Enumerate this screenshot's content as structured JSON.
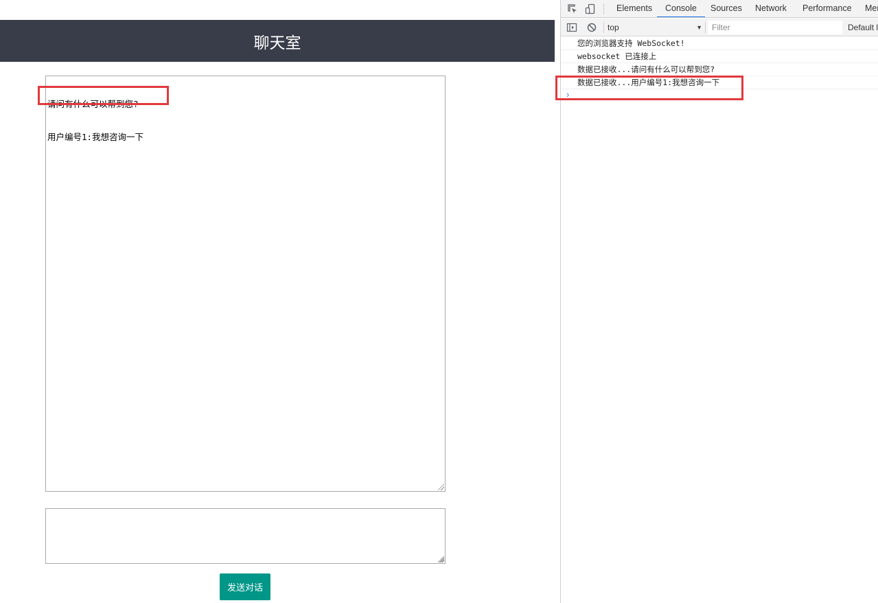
{
  "chat": {
    "title": "聊天室",
    "history": [
      "请问有什么可以帮到您?",
      "用户编号1:我想咨询一下"
    ],
    "input_value": "",
    "send_label": "发送对话"
  },
  "devtools": {
    "tabs": [
      {
        "label": "Elements"
      },
      {
        "label": "Console"
      },
      {
        "label": "Sources"
      },
      {
        "label": "Network"
      },
      {
        "label": "Performance"
      },
      {
        "label": "Mer"
      }
    ],
    "active_tab": "Console",
    "context": "top",
    "filter_placeholder": "Filter",
    "level": "Default l",
    "logs": [
      "您的浏览器支持 WebSocket!",
      "websocket 已连接上",
      "数据已接收...请问有什么可以帮到您?",
      "数据已接收...用户编号1:我想咨询一下"
    ],
    "prompt": "›"
  },
  "colors": {
    "header_bg": "#393d49",
    "button_bg": "#009688",
    "highlight": "#e0393e",
    "tab_accent": "#1a73e8"
  },
  "icons": {
    "inspect": "inspect-element-icon",
    "device": "device-toolbar-icon",
    "sidebar": "console-sidebar-icon",
    "clear": "clear-console-icon"
  }
}
